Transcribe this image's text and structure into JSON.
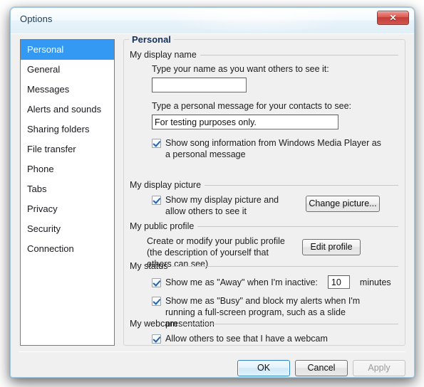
{
  "window": {
    "title": "Options",
    "close_label": "✕",
    "accent_selected": "#3399f3",
    "close_button_color": "#c23f38"
  },
  "sidebar": {
    "items": [
      {
        "label": "Personal",
        "selected": true
      },
      {
        "label": "General",
        "selected": false
      },
      {
        "label": "Messages",
        "selected": false
      },
      {
        "label": "Alerts and sounds",
        "selected": false
      },
      {
        "label": "Sharing folders",
        "selected": false
      },
      {
        "label": "File transfer",
        "selected": false
      },
      {
        "label": "Phone",
        "selected": false
      },
      {
        "label": "Tabs",
        "selected": false
      },
      {
        "label": "Privacy",
        "selected": false
      },
      {
        "label": "Security",
        "selected": false
      },
      {
        "label": "Connection",
        "selected": false
      }
    ]
  },
  "content": {
    "legend": "Personal",
    "display_name": {
      "group_title": "My display name",
      "name_label": "Type your name as you want others to see it:",
      "name_value": "",
      "name_placeholder": "",
      "message_label": "Type a personal message for your contacts to see:",
      "message_value": "For testing purposes only.",
      "message_placeholder": "",
      "song_checkbox_label": "Show song information from Windows Media Player as a personal message",
      "song_checkbox_checked": true
    },
    "display_picture": {
      "group_title": "My display picture",
      "checkbox_label": "Show my display picture and allow others to see it",
      "checkbox_checked": true,
      "button_label": "Change picture..."
    },
    "public_profile": {
      "group_title": "My public profile",
      "description": "Create or modify your public profile (the description of yourself that others can see)",
      "button_label": "Edit profile"
    },
    "status": {
      "group_title": "My status",
      "away_label_before": "Show me as \"Away\" when I'm inactive:",
      "away_minutes_value": "10",
      "away_label_after": "minutes",
      "away_checked": true,
      "busy_label": "Show me as \"Busy\" and block my alerts when I'm running a full-screen program, such as a slide presentation",
      "busy_checked": true
    },
    "webcam": {
      "group_title": "My webcam",
      "checkbox_label": "Allow others to see that I have a webcam",
      "checkbox_checked": true
    }
  },
  "footer": {
    "ok_label": "OK",
    "cancel_label": "Cancel",
    "apply_label": "Apply",
    "apply_enabled": false
  }
}
